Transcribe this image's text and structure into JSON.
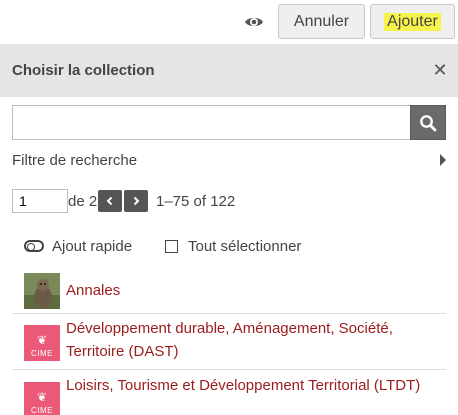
{
  "header": {
    "preview_icon": "eye-icon",
    "cancel_label": "Annuler",
    "add_label": "Ajouter",
    "add_highlight_color": "#f6f34a"
  },
  "panel": {
    "title": "Choisir la collection",
    "close_icon": "close-icon"
  },
  "search": {
    "value": "",
    "placeholder": "",
    "button_icon": "search-icon"
  },
  "filter": {
    "label": "Filtre de recherche",
    "icon": "caret-right-icon"
  },
  "pager": {
    "page": "1",
    "of_label": "de 2",
    "prev_icon": "chevron-left-icon",
    "next_icon": "chevron-right-icon",
    "range": "1–75 of 122"
  },
  "toolbar": {
    "quick_add_label": "Ajout rapide",
    "select_all_label": "Tout sélectionner"
  },
  "collections": [
    {
      "label": "Annales",
      "thumbnail": "marmot-photo"
    },
    {
      "label": "Développement durable, Aménagement, Société, Territoire (DAST)",
      "thumbnail": "cime-logo",
      "logo_text": "CIME"
    },
    {
      "label": "Loisirs, Tourisme et Développement Territorial (LTDT)",
      "thumbnail": "cime-logo",
      "logo_text": "CIME"
    }
  ],
  "colors": {
    "link": "#9b1c1c",
    "panel_header": "#e5e5e5",
    "logo_pink": "#ea5a78"
  }
}
